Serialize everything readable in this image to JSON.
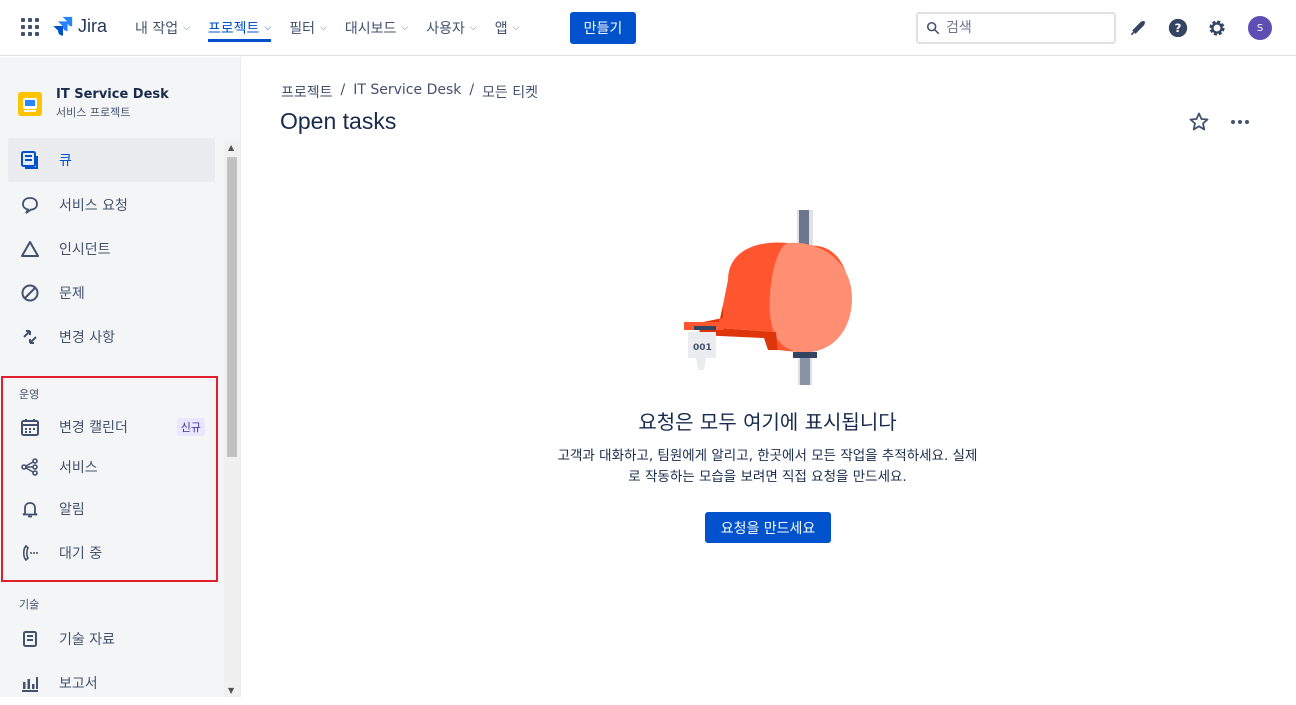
{
  "topnav": {
    "logo_text": "Jira",
    "items": [
      {
        "label": "내 작업"
      },
      {
        "label": "프로젝트"
      },
      {
        "label": "필터"
      },
      {
        "label": "대시보드"
      },
      {
        "label": "사용자"
      },
      {
        "label": "앱"
      }
    ],
    "create_label": "만들기",
    "search_placeholder": "검색",
    "avatar_initial": "S",
    "accent_color": "#0052cc"
  },
  "sidebar": {
    "project_name": "IT Service Desk",
    "project_type": "서비스 프로젝트",
    "items": [
      {
        "label": "큐",
        "icon": "queue-icon"
      },
      {
        "label": "서비스 요청",
        "icon": "speech-bubble-icon"
      },
      {
        "label": "인시던트",
        "icon": "triangle-warning-icon"
      },
      {
        "label": "문제",
        "icon": "prohibited-icon"
      },
      {
        "label": "변경 사항",
        "icon": "change-arrows-icon"
      }
    ],
    "section_operations": "운영",
    "operations_items": [
      {
        "label": "변경 캘린더",
        "icon": "calendar-icon",
        "badge": "신규"
      },
      {
        "label": "서비스",
        "icon": "services-icon"
      },
      {
        "label": "알림",
        "icon": "bell-icon"
      },
      {
        "label": "대기 중",
        "icon": "on-call-icon"
      }
    ],
    "section_knowledge": "기술",
    "knowledge_items": [
      {
        "label": "기술 자료",
        "icon": "book-icon"
      },
      {
        "label": "보고서",
        "icon": "bar-chart-icon"
      }
    ]
  },
  "main": {
    "breadcrumb": [
      "프로젝트",
      "IT Service Desk",
      "모든 티켓"
    ],
    "title": "Open tasks",
    "empty_title": "요청은 모두 여기에 표시됩니다",
    "empty_desc_line1": "고객과 대화하고, 팀원에게 알리고, 한곳에서 모든 작업을 추적하세요. 실제",
    "empty_desc_line2": "로 작동하는 모습을 보려면 직접 요청을 만드세요.",
    "cta_label": "요청을 만드세요",
    "ticket_number": "001"
  }
}
